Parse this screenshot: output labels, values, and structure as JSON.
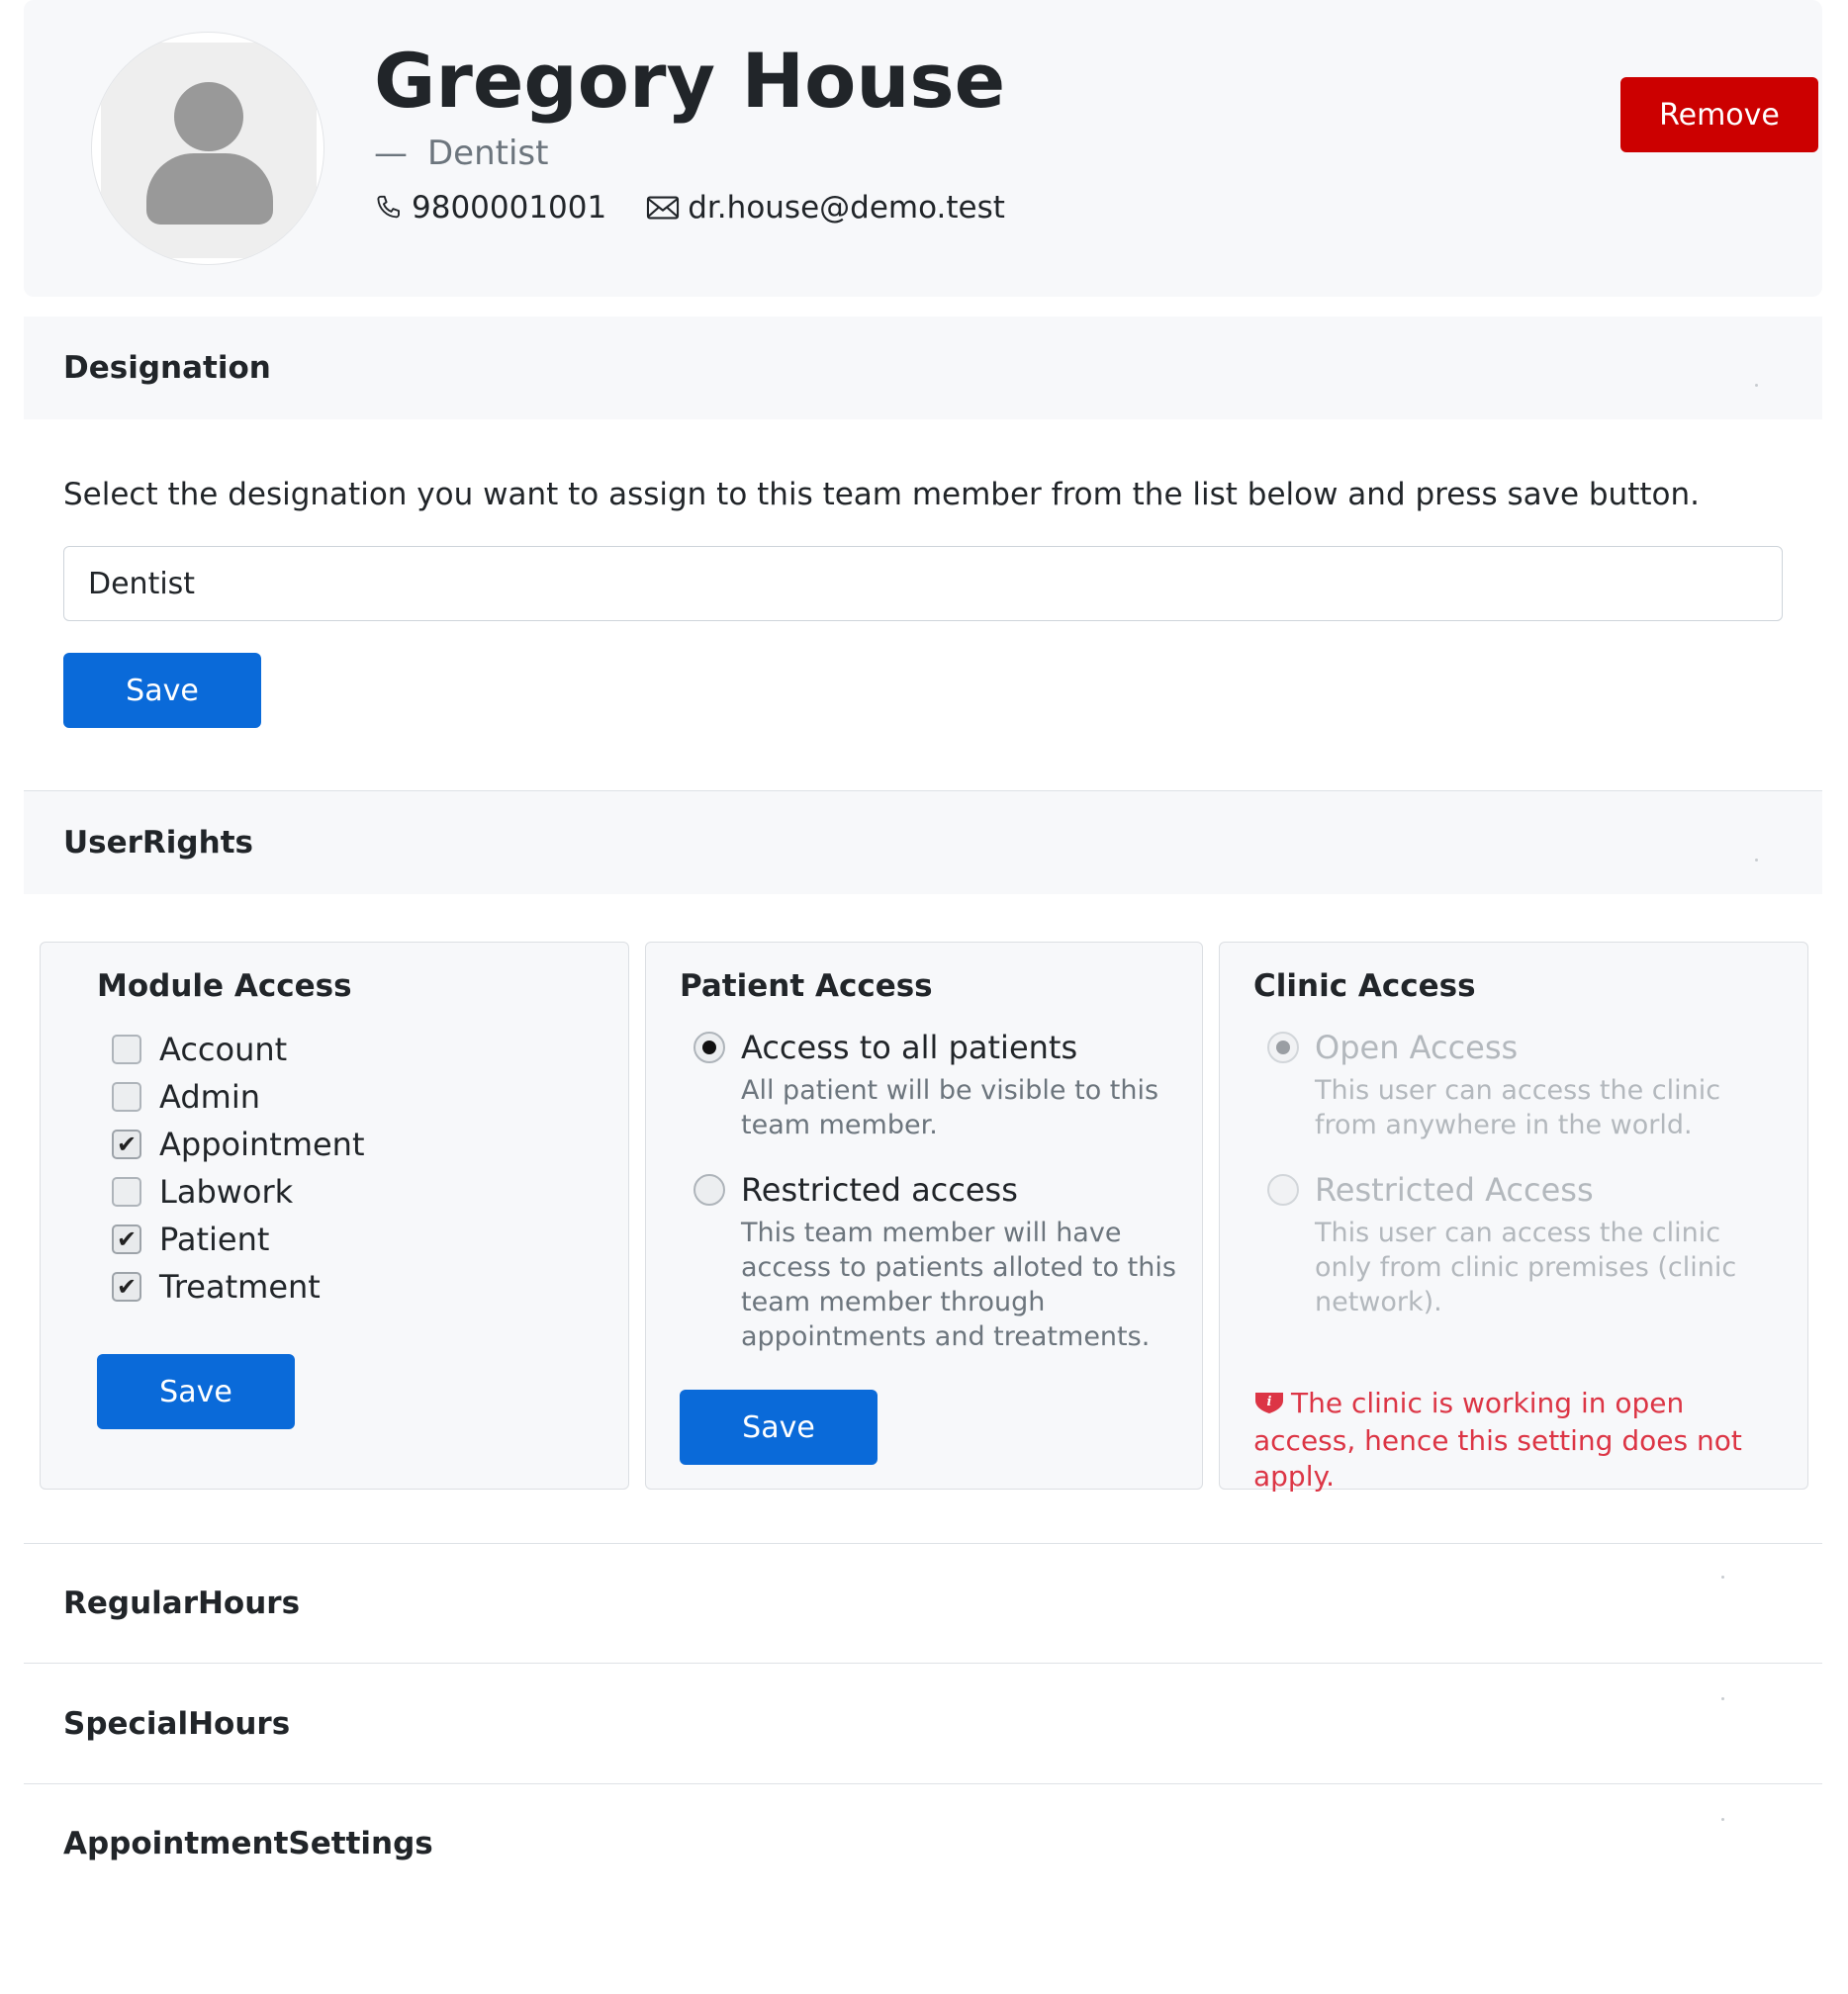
{
  "profile": {
    "name": "Gregory House",
    "designation_dash": "—",
    "designation": "Dentist",
    "phone": "9800001001",
    "email": "dr.house@demo.test",
    "remove_label": "Remove"
  },
  "sections": {
    "designation": {
      "title": "Designation",
      "help_text": "Select the designation you want to assign to this team member from the list below and press save button.",
      "selected_value": "Dentist",
      "save_label": "Save"
    },
    "user_rights": {
      "title": "UserRights",
      "module_access": {
        "title": "Module Access",
        "items": [
          {
            "label": "Account",
            "checked": false
          },
          {
            "label": "Admin",
            "checked": false
          },
          {
            "label": "Appointment",
            "checked": true
          },
          {
            "label": "Labwork",
            "checked": false
          },
          {
            "label": "Patient",
            "checked": true
          },
          {
            "label": "Treatment",
            "checked": true
          }
        ],
        "save_label": "Save"
      },
      "patient_access": {
        "title": "Patient Access",
        "options": [
          {
            "label": "Access to all patients",
            "description": "All patient will be visible to this team member.",
            "selected": true
          },
          {
            "label": "Restricted access",
            "description": "This team member will have access to patients alloted to this team member through appointments and treatments.",
            "selected": false
          }
        ],
        "save_label": "Save"
      },
      "clinic_access": {
        "title": "Clinic Access",
        "options": [
          {
            "label": "Open Access",
            "description": "This user can access the clinic from anywhere in the world.",
            "selected": true
          },
          {
            "label": "Restricted Access",
            "description": "This user can access the clinic only from clinic premises (clinic network).",
            "selected": false
          }
        ],
        "warning": "The clinic is working in open access, hence this setting does not apply."
      }
    },
    "regular_hours": {
      "title": "RegularHours"
    },
    "special_hours": {
      "title": "SpecialHours"
    },
    "appointment_settings": {
      "title": "AppointmentSettings"
    }
  },
  "colors": {
    "primary": "#0a6ad9",
    "danger_button": "#cc0000",
    "warning_text": "#dc3545",
    "panel_bg": "#f7f8fa"
  },
  "icons": {
    "phone": "phone-icon",
    "email": "envelope-icon",
    "warning": "exclamation-shield-icon",
    "check": "check-icon",
    "avatar": "user-silhouette-icon"
  }
}
